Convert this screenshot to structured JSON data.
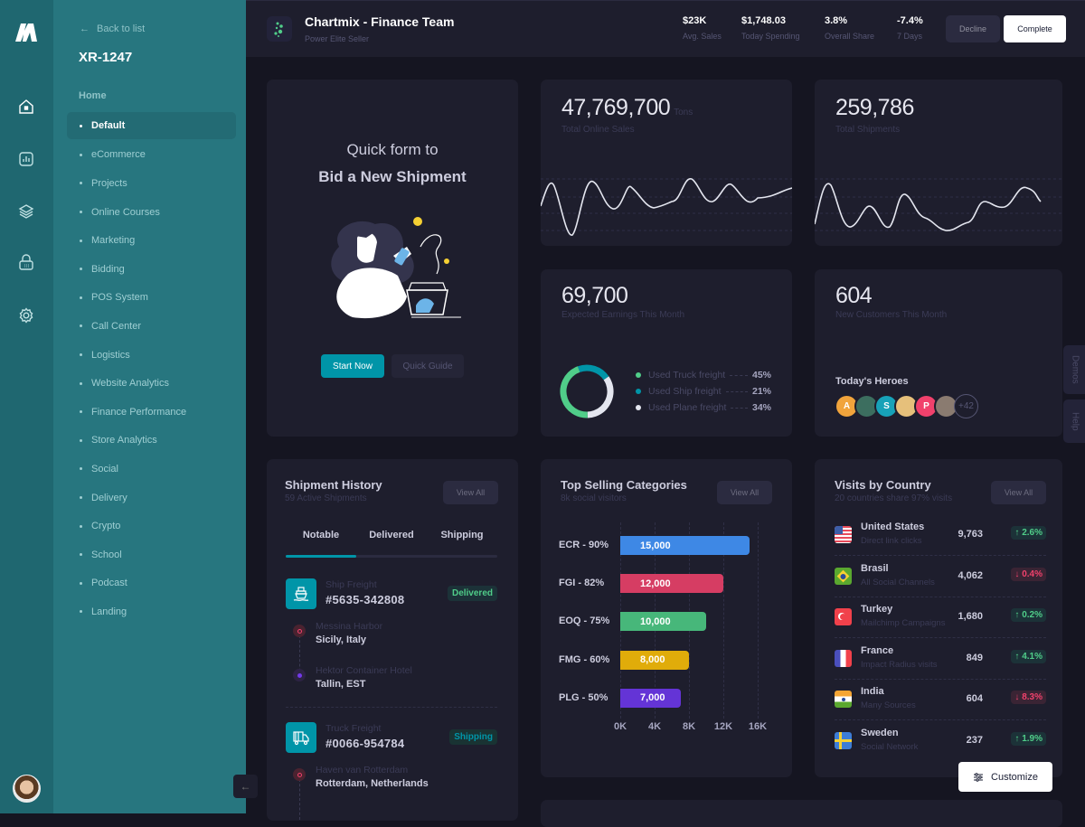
{
  "menu": {
    "back_label": "Back to list",
    "title": "XR-1247",
    "section": "Home",
    "items": [
      {
        "label": "Default",
        "active": true
      },
      {
        "label": "eCommerce"
      },
      {
        "label": "Projects"
      },
      {
        "label": "Online Courses"
      },
      {
        "label": "Marketing"
      },
      {
        "label": "Bidding"
      },
      {
        "label": "POS System"
      },
      {
        "label": "Call Center"
      },
      {
        "label": "Logistics"
      },
      {
        "label": "Website Analytics"
      },
      {
        "label": "Finance Performance"
      },
      {
        "label": "Store Analytics"
      },
      {
        "label": "Social"
      },
      {
        "label": "Delivery"
      },
      {
        "label": "Crypto"
      },
      {
        "label": "School"
      },
      {
        "label": "Podcast"
      },
      {
        "label": "Landing"
      }
    ]
  },
  "icon_nav": [
    "home-icon",
    "chart-icon",
    "layers-icon",
    "basket-icon",
    "gear-icon"
  ],
  "header": {
    "title": "Chartmix - Finance Team",
    "subtitle": "Power Elite Seller",
    "stats": [
      {
        "value": "$23K",
        "label": "Avg. Sales"
      },
      {
        "value": "$1,748.03",
        "label": "Today Spending"
      },
      {
        "value": "3.8%",
        "label": "Overall Share"
      },
      {
        "value": "-7.4%",
        "label": "7 Days"
      }
    ],
    "decline_label": "Decline",
    "complete_label": "Complete"
  },
  "promo": {
    "line1": "Quick form to",
    "line2": "Bid a New Shipment",
    "start_label": "Start Now",
    "guide_label": "Quick Guide"
  },
  "kpis": {
    "online_sales": {
      "value": "47,769,700",
      "unit": "Tons",
      "label": "Total Online Sales"
    },
    "shipments": {
      "value": "259,786",
      "label": "Total Shipments"
    },
    "earnings": {
      "value": "69,700",
      "label": "Expected Earnings This Month"
    },
    "customers": {
      "value": "604",
      "label": "New Customers This Month"
    }
  },
  "freight": [
    {
      "label": "Used Truck freight",
      "value": "45%",
      "pct": 45,
      "color": "#50cd89"
    },
    {
      "label": "Used Ship freight",
      "value": "21%",
      "pct": 21,
      "color": "#0095a8"
    },
    {
      "label": "Used Plane freight",
      "value": "34%",
      "pct": 34,
      "color": "#e4e6ef"
    }
  ],
  "heroes": {
    "title": "Today's Heroes",
    "avatars": [
      {
        "initial": "A",
        "color": "#f1a43c"
      },
      {
        "initial": "",
        "color": "#3c6e5f"
      },
      {
        "initial": "S",
        "color": "#17a2b8"
      },
      {
        "initial": "",
        "color": "#e6c07b"
      },
      {
        "initial": "P",
        "color": "#f1416c"
      },
      {
        "initial": "",
        "color": "#8a7b70"
      }
    ],
    "more": "+42"
  },
  "shipments": {
    "title": "Shipment History",
    "subtitle": "59 Active Shipments",
    "view_all": "View All",
    "tabs": [
      "Notable",
      "Delivered",
      "Shipping"
    ],
    "active_tab": 0,
    "items": [
      {
        "type": "Ship Freight",
        "id": "#5635-342808",
        "status": "Delivered",
        "stops": [
          {
            "name": "Messina Harbor",
            "loc": "Sicily, Italy"
          },
          {
            "name": "Hektor Container Hotel",
            "loc": "Tallin, EST"
          }
        ]
      },
      {
        "type": "Truck Freight",
        "id": "#0066-954784",
        "status": "Shipping",
        "stops": [
          {
            "name": "Haven van Rotterdam",
            "loc": "Rotterdam, Netherlands"
          }
        ]
      }
    ]
  },
  "top_selling": {
    "title": "Top Selling Categories",
    "subtitle": "8k social visitors",
    "view_all": "View All"
  },
  "chart_data": {
    "type": "bar",
    "orientation": "horizontal",
    "title": "Top Selling Categories",
    "categories": [
      "ECR - 90%",
      "FGI - 82%",
      "EOQ - 75%",
      "FMG - 60%",
      "PLG - 50%"
    ],
    "values": [
      15000,
      12000,
      10000,
      8000,
      7000
    ],
    "value_labels": [
      "15,000",
      "12,000",
      "10,000",
      "8,000",
      "7,000"
    ],
    "colors": [
      "#3e88e5",
      "#d63d63",
      "#47b77a",
      "#e0ac0a",
      "#6434d6"
    ],
    "xlim": [
      0,
      16000
    ],
    "xticks": [
      "0K",
      "4K",
      "8K",
      "12K",
      "16K"
    ],
    "grid": true
  },
  "countries": {
    "title": "Visits by Country",
    "subtitle": "20 countries share 97% visits",
    "view_all": "View All",
    "items": [
      {
        "name": "United States",
        "source": "Direct link clicks",
        "value": "9,763",
        "change": "2.6%",
        "dir": "up",
        "flag": "us"
      },
      {
        "name": "Brasil",
        "source": "All Social Channels",
        "value": "4,062",
        "change": "0.4%",
        "dir": "down",
        "flag": "br"
      },
      {
        "name": "Turkey",
        "source": "Mailchimp Campaigns",
        "value": "1,680",
        "change": "0.2%",
        "dir": "up",
        "flag": "tr"
      },
      {
        "name": "France",
        "source": "Impact Radius visits",
        "value": "849",
        "change": "4.1%",
        "dir": "up",
        "flag": "fr"
      },
      {
        "name": "India",
        "source": "Many Sources",
        "value": "604",
        "change": "8.3%",
        "dir": "down",
        "flag": "in"
      },
      {
        "name": "Sweden",
        "source": "Social Network",
        "value": "237",
        "change": "1.9%",
        "dir": "up",
        "flag": "se"
      }
    ]
  },
  "side_tabs": [
    "Demos",
    "Help"
  ],
  "customize_label": "Customize"
}
